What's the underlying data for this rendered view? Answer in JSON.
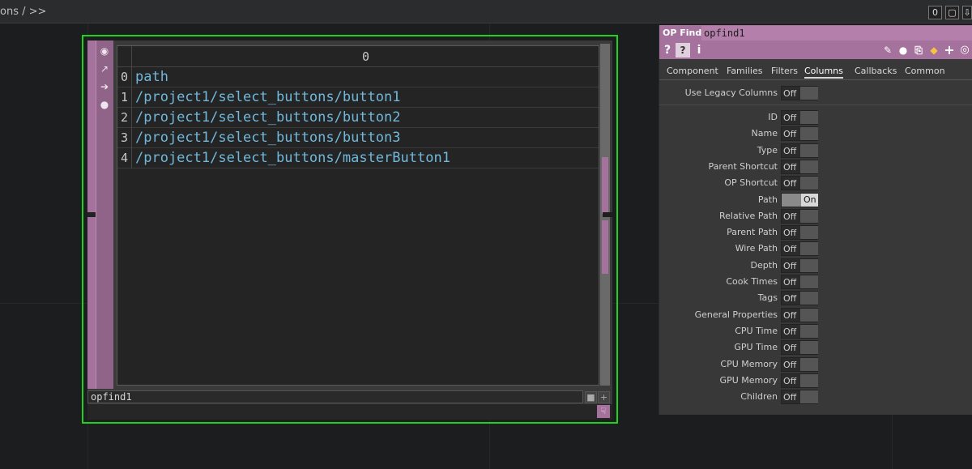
{
  "topbar": {
    "breadcrumb": "ons / >>",
    "pane_count": "0",
    "buttons": [
      "maximize-icon",
      "split-down-icon"
    ]
  },
  "node": {
    "name": "opfind1",
    "table": {
      "column_header": "0",
      "rows": [
        {
          "index": "0",
          "value": "path"
        },
        {
          "index": "1",
          "value": "/project1/select_buttons/button1"
        },
        {
          "index": "2",
          "value": "/project1/select_buttons/button2"
        },
        {
          "index": "3",
          "value": "/project1/select_buttons/button3"
        },
        {
          "index": "4",
          "value": "/project1/select_buttons/masterButton1"
        }
      ]
    },
    "colors": {
      "outline": "#1bd41b",
      "dat_accent": "#a4729c",
      "path_text": "#70b9dc"
    }
  },
  "panel": {
    "type_label": "OP Find",
    "op_name": "opfind1",
    "tabs": [
      "Component",
      "Families",
      "Filters",
      "Columns",
      "Callbacks",
      "Common"
    ],
    "active_tab": "Columns",
    "legacy": {
      "label": "Use Legacy Columns",
      "value": "Off"
    },
    "params": [
      {
        "label": "ID",
        "value": "Off"
      },
      {
        "label": "Name",
        "value": "Off"
      },
      {
        "label": "Type",
        "value": "Off"
      },
      {
        "label": "Parent Shortcut",
        "value": "Off"
      },
      {
        "label": "OP Shortcut",
        "value": "Off"
      },
      {
        "label": "Path",
        "value": "On"
      },
      {
        "label": "Relative Path",
        "value": "Off"
      },
      {
        "label": "Parent Path",
        "value": "Off"
      },
      {
        "label": "Wire Path",
        "value": "Off"
      },
      {
        "label": "Depth",
        "value": "Off"
      },
      {
        "label": "Cook Times",
        "value": "Off"
      },
      {
        "label": "Tags",
        "value": "Off"
      },
      {
        "label": "General Properties",
        "value": "Off"
      },
      {
        "label": "CPU Time",
        "value": "Off"
      },
      {
        "label": "GPU Time",
        "value": "Off"
      },
      {
        "label": "CPU Memory",
        "value": "Off"
      },
      {
        "label": "GPU Memory",
        "value": "Off"
      },
      {
        "label": "Children",
        "value": "Off"
      }
    ]
  }
}
